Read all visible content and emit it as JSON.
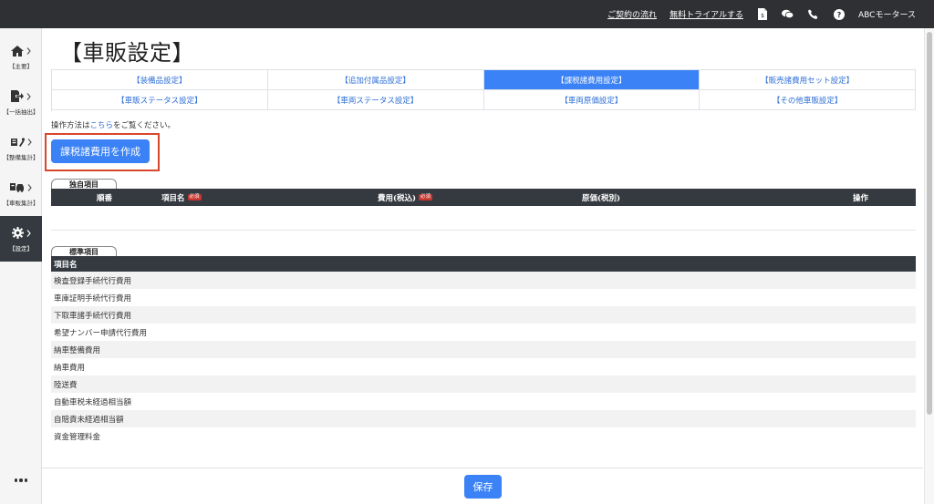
{
  "topbar": {
    "link_contract_flow": "ご契約の流れ",
    "link_free_trial": "無料トライアルする",
    "company_name": "ABCモータース",
    "icons": [
      "document-icon",
      "chat-icon",
      "phone-icon",
      "help-icon"
    ]
  },
  "sidebar": {
    "items": [
      {
        "label": "【主要】",
        "icon": "home-icon"
      },
      {
        "label": "【一括抽出】",
        "icon": "export-icon"
      },
      {
        "label": "【整備集計】",
        "icon": "tools-icon"
      },
      {
        "label": "【車販集計】",
        "icon": "car-icon"
      },
      {
        "label": "【設定】",
        "icon": "gear-icon",
        "active": true
      }
    ],
    "more_icon": "more-icon"
  },
  "page": {
    "title": "【車販設定】",
    "tabs": [
      {
        "label": "【装備品設定】"
      },
      {
        "label": "【追加付属品設定】"
      },
      {
        "label": "【課税諸費用設定】",
        "active": true
      },
      {
        "label": "【販売諸費用セット設定】"
      },
      {
        "label": "【車販ステータス設定】"
      },
      {
        "label": "【車両ステータス設定】"
      },
      {
        "label": "【車両原価設定】"
      },
      {
        "label": "【その他車販設定】"
      }
    ],
    "howto_prefix": "操作方法は",
    "howto_link": "こちら",
    "howto_suffix": "をご覧ください。",
    "create_button": "課税諸費用を作成",
    "save_button": "保存"
  },
  "custom_section": {
    "label": "独自項目",
    "columns": {
      "order": "順番",
      "item_name": "項目名",
      "cost_tax_incl": "費用(税込)",
      "original_cost": "原価(税別)",
      "action": "操作"
    },
    "required_badge": "必須"
  },
  "standard_section": {
    "label": "標準項目",
    "column_item_name": "項目名",
    "rows": [
      "検査登録手続代行費用",
      "車庫証明手続代行費用",
      "下取車諸手続代行費用",
      "希望ナンバー申請代行費用",
      "納車整備費用",
      "納車費用",
      "陸送費",
      "自動車税未経過相当額",
      "自賠責未経過相当額",
      "資金管理料金"
    ]
  },
  "colors": {
    "topbar_bg": "#2f3033",
    "primary": "#3b82f6",
    "link": "#2f6fd6",
    "highlight_frame": "#d9472b",
    "required_badge": "#c8352f",
    "table_header": "#343a40"
  }
}
